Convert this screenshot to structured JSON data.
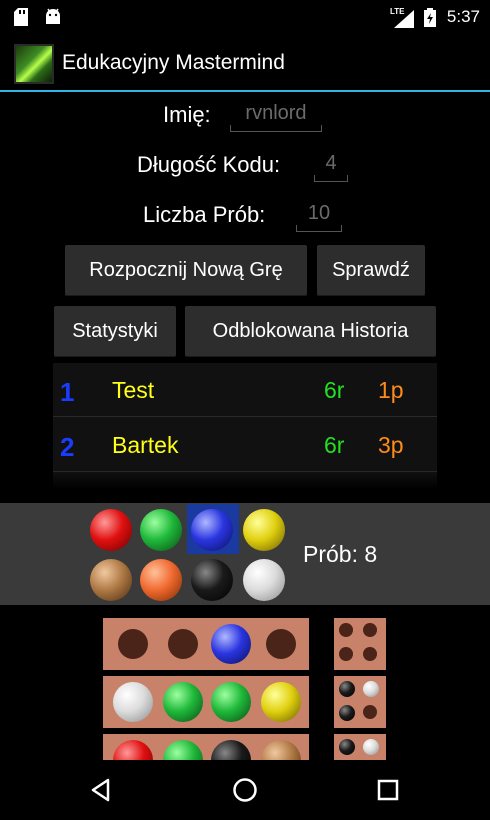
{
  "status": {
    "time": "5:37",
    "network": "LTE"
  },
  "app": {
    "title": "Edukacyjny Mastermind"
  },
  "form": {
    "name_label": "Imię:",
    "name_placeholder": "rvnlord",
    "code_length_label": "Długość Kodu:",
    "code_length_placeholder": "4",
    "tries_label": "Liczba Prób:",
    "tries_placeholder": "10"
  },
  "buttons": {
    "new_game": "Rozpocznij Nową Grę",
    "check": "Sprawdź",
    "stats": "Statystyki",
    "history": "Odblokowana Historia"
  },
  "scores": [
    {
      "rank": "1",
      "name": "Test",
      "correct": "6r",
      "partial": "1p"
    },
    {
      "rank": "2",
      "name": "Bartek",
      "correct": "6r",
      "partial": "3p"
    }
  ],
  "palette": {
    "colors": [
      "red",
      "green",
      "blue",
      "yellow",
      "brown",
      "orange",
      "black",
      "white"
    ],
    "selected": "blue",
    "attempts_text": "Prób: 8"
  },
  "board": [
    {
      "pegs": [
        "empty",
        "empty",
        "blue",
        "empty"
      ],
      "hints": [
        "empty",
        "empty",
        "empty",
        "empty"
      ]
    },
    {
      "pegs": [
        "white",
        "green",
        "green",
        "yellow"
      ],
      "hints": [
        "black",
        "white",
        "black",
        "empty"
      ]
    },
    {
      "pegs": [
        "red",
        "green",
        "black",
        "brown"
      ],
      "hints": [
        "black",
        "white",
        "empty",
        "empty"
      ]
    }
  ],
  "colors": {
    "accent": "#33b5e5",
    "board": "#c9826a",
    "rank": "#1a3cff",
    "player": "#ffff1a",
    "correct": "#22e022",
    "partial": "#ff8c1a"
  }
}
